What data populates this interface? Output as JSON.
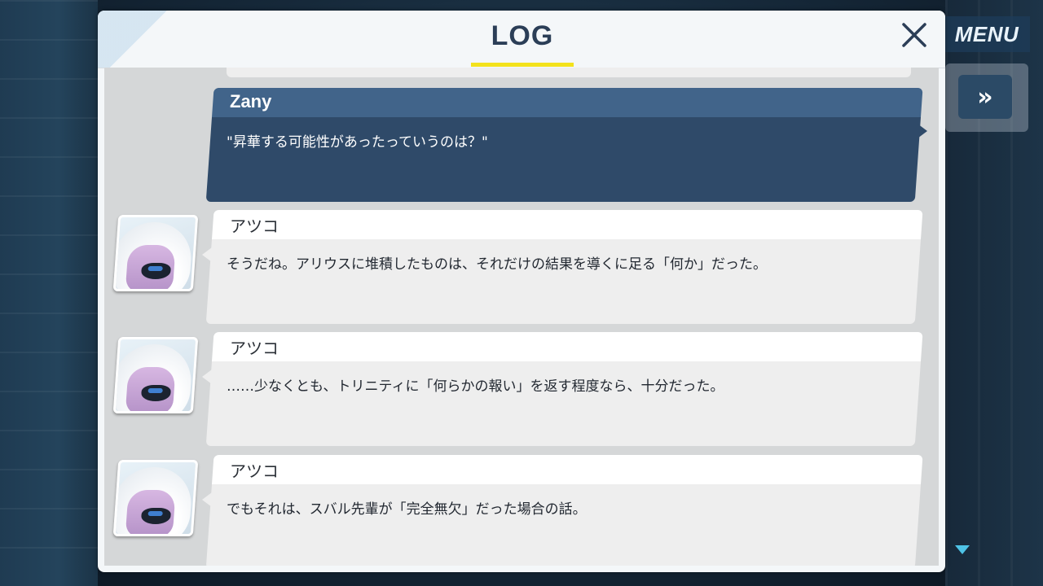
{
  "panel": {
    "title": "LOG",
    "close_icon": "close-icon"
  },
  "hud": {
    "menu_label": "MENU",
    "skip_label": "»",
    "skip_icon": "fast-forward-icon",
    "scroll_icon": "scroll-down-icon"
  },
  "messages": [
    {
      "speaker": "Zany",
      "text": "\"昇華する可能性があったっていうのは？\"",
      "is_player": true
    },
    {
      "speaker": "アツコ",
      "text": "そうだね。アリウスに堆積したものは、それだけの結果を導くに足る「何か」だった。",
      "avatar": "character-avatar"
    },
    {
      "speaker": "アツコ",
      "text": "……少なくとも、トリニティに「何らかの報い」を返す程度なら、十分だった。",
      "avatar": "character-avatar"
    },
    {
      "speaker": "アツコ",
      "text": "でもそれは、スバル先輩が「完全無欠」だった場合の話。",
      "avatar": "character-avatar"
    }
  ],
  "colors": {
    "title": "#2b3e57",
    "underline": "#f3e21b",
    "player_name_bar": "#41648a",
    "player_body": "#2f4a69"
  }
}
